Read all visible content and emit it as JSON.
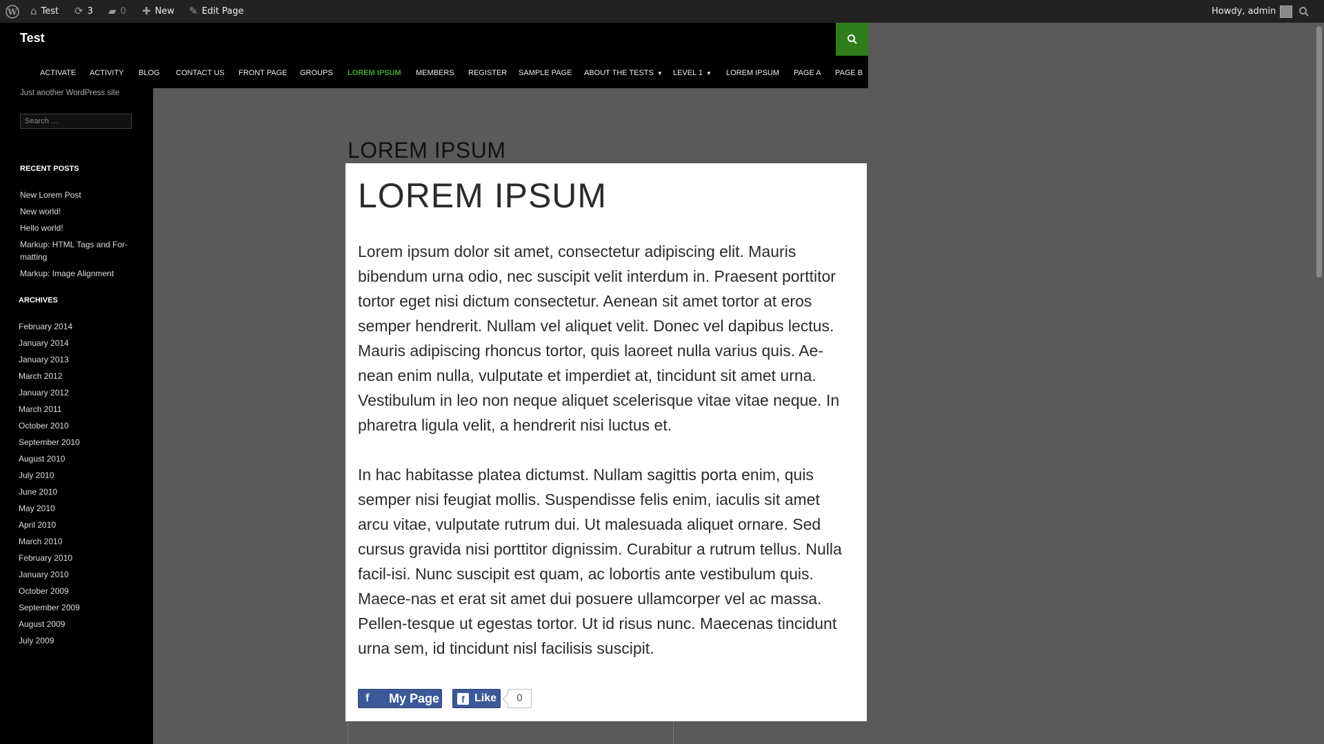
{
  "admin_bar": {
    "site_name": "Test",
    "updates_count": "3",
    "comments_count": "0",
    "new_label": "New",
    "edit_label": "Edit Page",
    "greeting": "Howdy, admin"
  },
  "header": {
    "site_title": "Test",
    "nav": [
      {
        "label": "ACTIVATE"
      },
      {
        "label": "ACTIVITY"
      },
      {
        "label": "BLOG"
      },
      {
        "label": "CONTACT US"
      },
      {
        "label": "FRONT PAGE"
      },
      {
        "label": "GROUPS"
      },
      {
        "label": "LOREM IPSUM",
        "active": true
      },
      {
        "label": "MEMBERS"
      },
      {
        "label": "REGISTER"
      },
      {
        "label": "SAMPLE PAGE"
      },
      {
        "label": "ABOUT THE TESTS"
      },
      {
        "label": "LEVEL 1"
      },
      {
        "label": "LOREM IPSUM"
      },
      {
        "label": "PAGE A"
      },
      {
        "label": "PAGE B"
      }
    ]
  },
  "sidebar": {
    "tagline": "Just another WordPress site",
    "search_placeholder": "Search …",
    "recent_posts_title": "RECENT POSTS",
    "recent_posts": [
      "New Lorem Post",
      "New world!",
      "Hello world!",
      "Markup: HTML Tags and For-",
      "matting",
      "Markup: Image Alignment"
    ],
    "archives_title": "ARCHIVES",
    "archives": [
      "February 2014",
      "January 2014",
      "January 2013",
      "March 2012",
      "January 2012",
      "March 2011",
      "October 2010",
      "September 2010",
      "August 2010",
      "July 2010",
      "June 2010",
      "May 2010",
      "April 2010",
      "March 2010",
      "February 2010",
      "January 2010",
      "October 2009",
      "September 2009",
      "August 2009",
      "July 2009"
    ]
  },
  "page": {
    "heading": "LOREM IPSUM"
  },
  "modal": {
    "title": "LOREM IPSUM",
    "para1": "Lorem ipsum dolor sit amet, consectetur adipiscing elit. Mauris bibendum urna odio, nec suscipit velit interdum in. Praesent porttitor tortor eget nisi dictum consectetur. Aenean sit amet tortor at eros semper hendrerit. Nullam vel aliquet velit. Donec vel dapibus lectus. Mauris adipiscing rhoncus tortor, quis laoreet nulla varius quis. Ae-nean enim nulla, vulputate et imperdiet at, tincidunt sit amet urna. Vestibulum in leo non neque aliquet scelerisque vitae vitae neque. In pharetra ligula velit, a hendrerit nisi luctus et.",
    "para2": "In hac habitasse platea dictumst. Nullam sagittis porta enim, quis semper nisi feugiat mollis. Suspendisse felis enim, iaculis sit amet arcu vitae, vulputate rutrum dui. Ut malesuada aliquet ornare. Sed cursus gravida nisi porttitor dignissim. Curabitur a rutrum tellus. Nulla facil-isi. Nunc suscipit est quam, ac lobortis ante vestibulum quis. Maece-nas et erat sit amet dui posuere ullamcorper vel ac massa. Pellen-tesque ut egestas tortor. Ut id risus nunc. Maecenas tincidunt urna sem, id tincidunt nisl facilisis suscipit.",
    "share_label": "My Page",
    "like_label": "Like",
    "like_count": "0"
  },
  "colors": {
    "accent": "#41a62a",
    "facebook": "#3b5998"
  }
}
